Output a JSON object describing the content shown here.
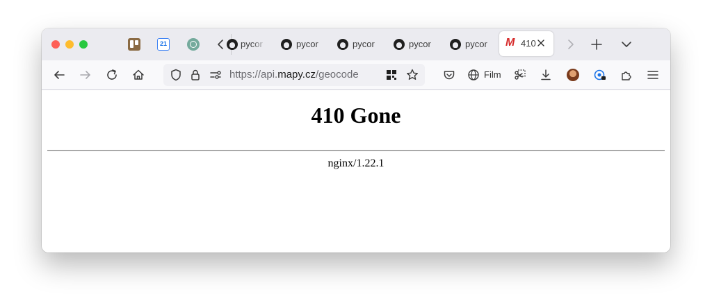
{
  "browser": {
    "pinned_tabs": [
      {
        "icon": "trello-icon"
      },
      {
        "icon": "calendar-icon",
        "text": "21"
      },
      {
        "icon": "chatgpt-icon"
      }
    ],
    "tabs": [
      {
        "label": "pycor",
        "icon": "github-icon"
      },
      {
        "label": "pycor",
        "icon": "github-icon"
      },
      {
        "label": "pycor",
        "icon": "github-icon"
      },
      {
        "label": "pycor",
        "icon": "github-icon"
      },
      {
        "label": "pycor",
        "icon": "github-icon"
      }
    ],
    "active_tab": {
      "label": "410",
      "icon": "mapy-icon",
      "icon_text": "M"
    },
    "url": {
      "prefix": "https://api.",
      "host": "mapy.cz",
      "path": "/geocode"
    },
    "toolbar": {
      "film_label": "Film"
    }
  },
  "page": {
    "title": "410 Gone",
    "server": "nginx/1.22.1"
  },
  "colors": {
    "tab_bar": "#ebebf0",
    "nav_bar": "#f9f9fb",
    "close": "#fe5f57",
    "minimize": "#febc2e",
    "maximize": "#28c840",
    "mapy_red": "#d62b2b"
  }
}
